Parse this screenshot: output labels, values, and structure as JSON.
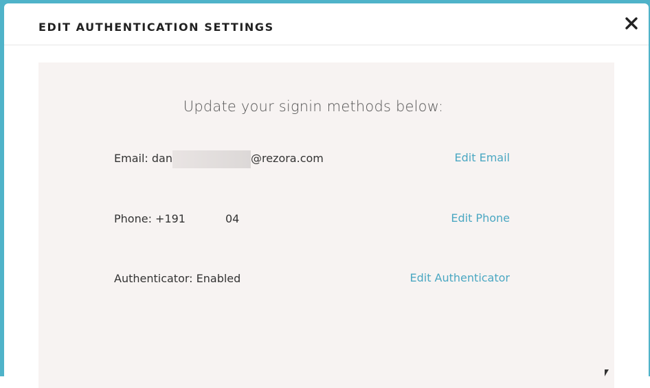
{
  "modal": {
    "title": "EDIT AUTHENTICATION SETTINGS",
    "close_icon": "close-icon"
  },
  "content": {
    "subtitle": "Update your signin methods below:",
    "email": {
      "label_prefix": "Email: dan",
      "label_suffix": "@rezora.com",
      "action": "Edit Email"
    },
    "phone": {
      "label_prefix": "Phone: +191",
      "label_suffix": "04",
      "action": "Edit Phone"
    },
    "authenticator": {
      "label": "Authenticator: Enabled",
      "action": "Edit Authenticator"
    }
  },
  "colors": {
    "accent": "#4aa7c2",
    "panel_bg": "#f7f3f2",
    "backdrop": "#4fb3c9"
  }
}
